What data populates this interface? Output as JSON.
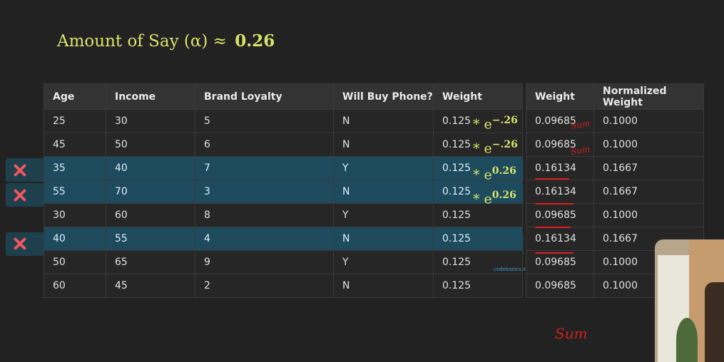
{
  "title": {
    "label": "Amount of Say (α) ≈",
    "value": "0.26"
  },
  "main_table": {
    "headers": [
      "Age",
      "Income",
      "Brand Loyalty",
      "Will Buy Phone?",
      "Weight"
    ],
    "rows": [
      [
        "25",
        "30",
        "5",
        "N",
        "0.125"
      ],
      [
        "45",
        "50",
        "6",
        "N",
        "0.125"
      ],
      [
        "35",
        "40",
        "7",
        "Y",
        "0.125"
      ],
      [
        "55",
        "70",
        "3",
        "N",
        "0.125"
      ],
      [
        "30",
        "60",
        "8",
        "Y",
        "0.125"
      ],
      [
        "40",
        "55",
        "4",
        "N",
        "0.125"
      ],
      [
        "50",
        "65",
        "9",
        "Y",
        "0.125"
      ],
      [
        "60",
        "45",
        "2",
        "N",
        "0.125"
      ]
    ],
    "misclassified_rows": [
      2,
      3,
      5
    ]
  },
  "multipliers": [
    {
      "base": "* e",
      "exp": "−.26"
    },
    {
      "base": "* e",
      "exp": "−.26"
    },
    {
      "base": "* e",
      "exp": "0.26"
    },
    {
      "base": "* e",
      "exp": "0.26"
    }
  ],
  "weight_table": {
    "headers": [
      "Weight",
      "Normalized Weight"
    ],
    "rows": [
      [
        "0.09685",
        "0.1000"
      ],
      [
        "0.09685",
        "0.1000"
      ],
      [
        "0.16134",
        "0.1667"
      ],
      [
        "0.16134",
        "0.1667"
      ],
      [
        "0.09685",
        "0.1000"
      ],
      [
        "0.16134",
        "0.1667"
      ],
      [
        "0.09685",
        "0.1000"
      ],
      [
        "0.09685",
        "0.1000"
      ]
    ]
  },
  "annotations": {
    "sum_bottom": "Sum",
    "sum_small": "Sum"
  },
  "watermark": "codebasics.io",
  "colors": {
    "accent_yellow": "#d7e36a",
    "highlight": "#1e4a5e",
    "x_mark": "#f0565f",
    "ink": "#d21e1e"
  }
}
